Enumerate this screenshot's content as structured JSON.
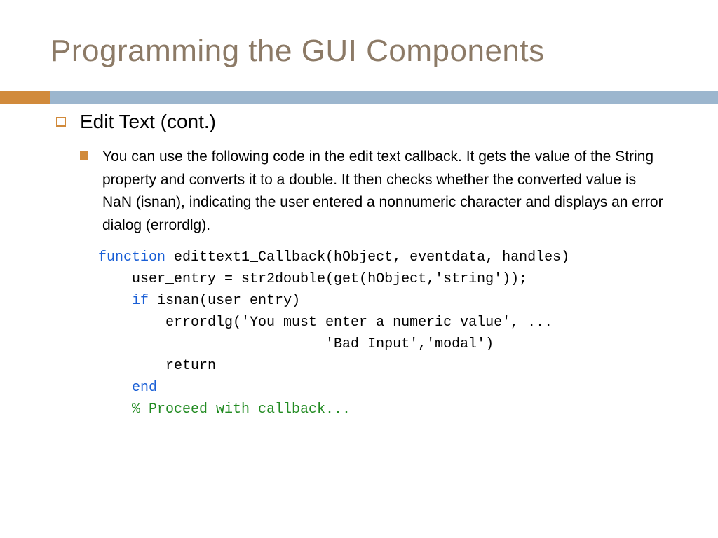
{
  "title": "Programming the GUI Components",
  "subtitle": "Edit Text (cont.)",
  "body": "You can use the following code in the edit text callback. It gets the value of the String property and converts it to a double. It then checks whether the converted value is NaN (isnan), indicating the user entered a nonnumeric character and displays an error dialog (errordlg).",
  "code": {
    "l1a": "function",
    "l1b": " edittext1_Callback(hObject, eventdata, handles)",
    "l2": "    user_entry = str2double(get(hObject,'string'));",
    "l3a": "    ",
    "l3b": "if",
    "l3c": " isnan(user_entry)",
    "l4": "        errordlg('You must enter a numeric value', ...",
    "l5": "                           'Bad Input','modal')",
    "l6": "        return",
    "l7a": "    ",
    "l7b": "end",
    "l8": "    % Proceed with callback..."
  }
}
